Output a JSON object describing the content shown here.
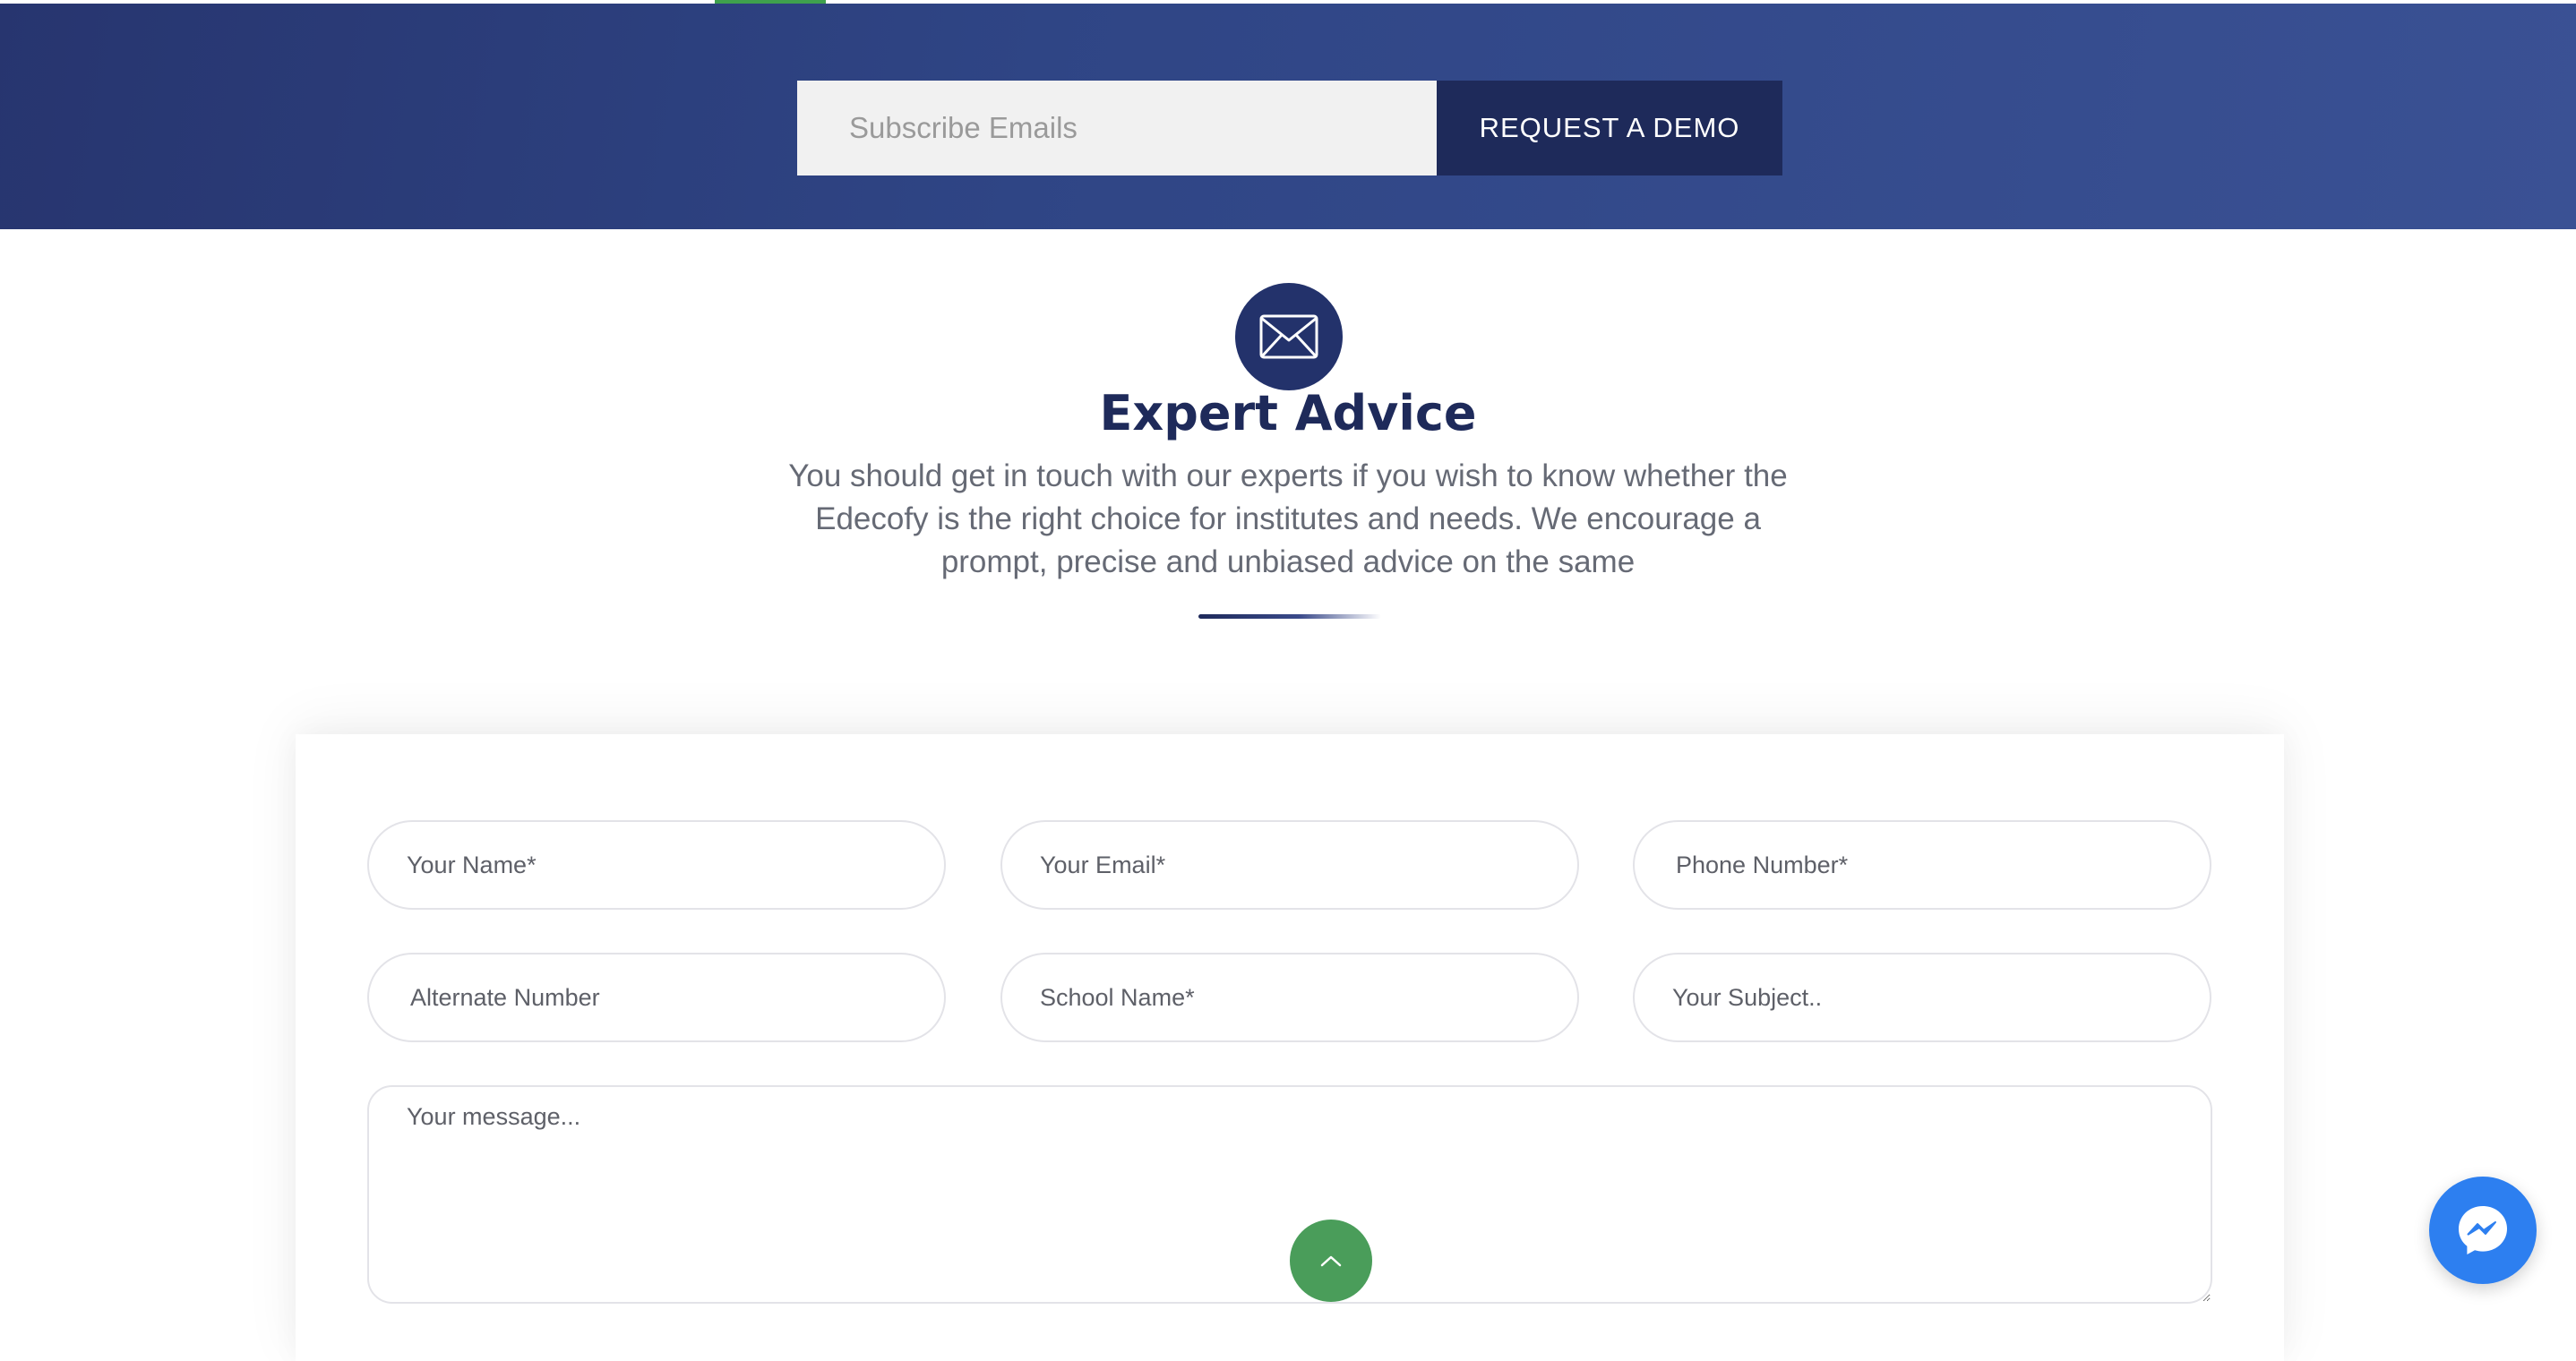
{
  "subscribe": {
    "placeholder": "Subscribe Emails",
    "button_label": "REQUEST A DEMO"
  },
  "expert_advice": {
    "icon": "envelope-icon",
    "title": "Expert Advice",
    "description": "You should get in touch with our experts if you wish to know whether the Edecofy is the right choice for institutes and needs. We encourage a prompt, precise and unbiased advice on the same"
  },
  "form": {
    "name_placeholder": "Your Name*",
    "email_placeholder": "Your Email*",
    "phone_placeholder": "Phone Number*",
    "alternate_placeholder": "Alternate Number",
    "school_placeholder": "School Name*",
    "subject_placeholder": "Your Subject..",
    "message_placeholder": "Your message..."
  },
  "floating": {
    "scroll_top_icon": "chevron-up-icon",
    "messenger_icon": "messenger-icon"
  },
  "colors": {
    "brand_navy": "#1e2a5a",
    "band_gradient_start": "#27356f",
    "band_gradient_end": "#3a5194",
    "scroll_top_green": "#4a9d5a",
    "messenger_blue": "#2d7ff0"
  }
}
